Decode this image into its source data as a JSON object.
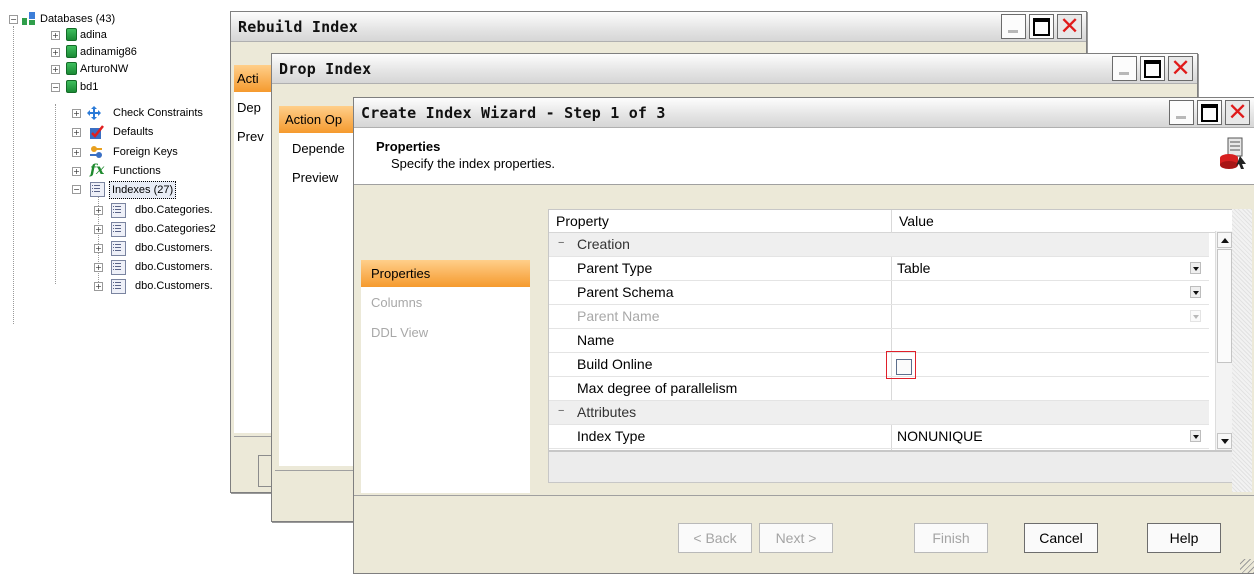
{
  "tree": {
    "root": "Databases (43)",
    "databases": [
      "adina",
      "adinamig86",
      "ArturoNW",
      "bd1"
    ],
    "bd1_children": [
      "Check Constraints",
      "Defaults",
      "Foreign Keys",
      "Functions",
      "Indexes (27)"
    ],
    "indexes": [
      "dbo.Categories.",
      "dbo.Categories2",
      "dbo.Customers.",
      "dbo.Customers.",
      "dbo.Customers."
    ],
    "expand_plus": "+",
    "expand_minus": "−"
  },
  "rebuild_window": {
    "title": "Rebuild Index",
    "sidebar": [
      "Acti",
      "Dep",
      "Prev"
    ]
  },
  "drop_window": {
    "title": "Drop Index",
    "sidebar": [
      "Action Op",
      "Depende",
      "Preview"
    ]
  },
  "wizard": {
    "title": "Create Index Wizard - Step 1 of 3",
    "header_title": "Properties",
    "header_subtitle": "Specify the index properties.",
    "sidebar": [
      "Properties",
      "Columns",
      "DDL View"
    ],
    "grid": {
      "col_property": "Property",
      "col_value": "Value",
      "categories": {
        "creation": "Creation",
        "attributes": "Attributes"
      },
      "rows": [
        {
          "property": "Parent Type",
          "value": "Table"
        },
        {
          "property": "Parent Schema",
          "value": ""
        },
        {
          "property": "Parent Name",
          "value": ""
        },
        {
          "property": "Name",
          "value": ""
        },
        {
          "property": "Build Online",
          "value": ""
        },
        {
          "property": "Max degree of parallelism",
          "value": ""
        },
        {
          "property": "Index Type",
          "value": "NONUNIQUE"
        }
      ],
      "build_online_checked": false
    },
    "buttons": {
      "back": "< Back",
      "next": "Next >",
      "finish": "Finish",
      "cancel": "Cancel",
      "help": "Help"
    },
    "close_glyph": "✕"
  },
  "colors": {
    "accent_tab": "#f59a2e",
    "close": "#e01a1a",
    "highlight": "#e0202a"
  }
}
